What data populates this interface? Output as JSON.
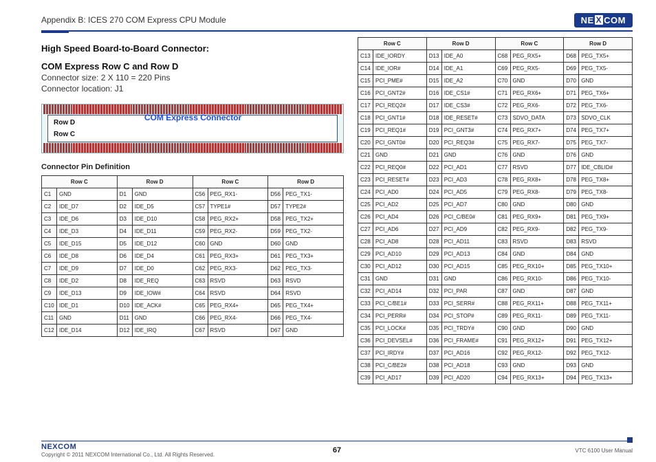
{
  "header": {
    "section": "Appendix B: ICES 270 COM Express CPU Module",
    "brand": "NEXCOM"
  },
  "title_block": {
    "line1": "High Speed Board-to-Board Connector:",
    "line2": "COM Express Row C and Row D",
    "size": "Connector size: 2 X 110 = 220 Pins",
    "location": "Connector location: J1"
  },
  "diagram": {
    "row_d_label": "Row D",
    "row_c_label": "Row C",
    "conn_title": "COM Express Connector"
  },
  "pin_def_title": "Connector Pin Definition",
  "table_headers": {
    "rowC": "Row C",
    "rowD": "Row D"
  },
  "left_table_rows": [
    [
      "C1",
      "GND",
      "D1",
      "GND",
      "C56",
      "PEG_RX1-",
      "D56",
      "PEG_TX1-"
    ],
    [
      "C2",
      "IDE_D7",
      "D2",
      "IDE_D5",
      "C57",
      "TYPE1#",
      "D57",
      "TYPE2#"
    ],
    [
      "C3",
      "IDE_D6",
      "D3",
      "IDE_D10",
      "C58",
      "PEG_RX2+",
      "D58",
      "PEG_TX2+"
    ],
    [
      "C4",
      "IDE_D3",
      "D4",
      "IDE_D11",
      "C59",
      "PEG_RX2-",
      "D59",
      "PEG_TX2-"
    ],
    [
      "C5",
      "IDE_D15",
      "D5",
      "IDE_D12",
      "C60",
      "GND",
      "D60",
      "GND"
    ],
    [
      "C6",
      "IDE_D8",
      "D6",
      "IDE_D4",
      "C61",
      "PEG_RX3+",
      "D61",
      "PEG_TX3+"
    ],
    [
      "C7",
      "IDE_D9",
      "D7",
      "IDE_D0",
      "C62",
      "PEG_RX3-",
      "D62",
      "PEG_TX3-"
    ],
    [
      "C8",
      "IDE_D2",
      "D8",
      "IDE_REQ",
      "C63",
      "RSVD",
      "D63",
      "RSVD"
    ],
    [
      "C9",
      "IDE_D13",
      "D9",
      "IDE_IOW#",
      "C64",
      "RSVD",
      "D64",
      "RSVD"
    ],
    [
      "C10",
      "IDE_D1",
      "D10",
      "IDE_ACK#",
      "C65",
      "PEG_RX4+",
      "D65",
      "PEG_TX4+"
    ],
    [
      "C11",
      "GND",
      "D11",
      "GND",
      "C66",
      "PEG_RX4-",
      "D66",
      "PEG_TX4-"
    ],
    [
      "C12",
      "IDE_D14",
      "D12",
      "IDE_IRQ",
      "C67",
      "RSVD",
      "D67",
      "GND"
    ]
  ],
  "right_table_rows": [
    [
      "C13",
      "IDE_IORDY",
      "D13",
      "IDE_A0",
      "C68",
      "PEG_RX5+",
      "D68",
      "PEG_TX5+"
    ],
    [
      "C14",
      "IDE_IOR#",
      "D14",
      "IDE_A1",
      "C69",
      "PEG_RX5-",
      "D69",
      "PEG_TX5-"
    ],
    [
      "C15",
      "PCI_PME#",
      "D15",
      "IDE_A2",
      "C70",
      "GND",
      "D70",
      "GND"
    ],
    [
      "C16",
      "PCI_GNT2#",
      "D16",
      "IDE_CS1#",
      "C71",
      "PEG_RX6+",
      "D71",
      "PEG_TX6+"
    ],
    [
      "C17",
      "PCI_REQ2#",
      "D17",
      "IDE_CS3#",
      "C72",
      "PEG_RX6-",
      "D72",
      "PEG_TX6-"
    ],
    [
      "C18",
      "PCI_GNT1#",
      "D18",
      "IDE_RESET#",
      "C73",
      "SDVO_DATA",
      "D73",
      "SDVO_CLK"
    ],
    [
      "C19",
      "PCI_REQ1#",
      "D19",
      "PCI_GNT3#",
      "C74",
      "PEG_RX7+",
      "D74",
      "PEG_TX7+"
    ],
    [
      "C20",
      "PCI_GNT0#",
      "D20",
      "PCI_REQ3#",
      "C75",
      "PEG_RX7-",
      "D75",
      "PEG_TX7-"
    ],
    [
      "C21",
      "GND",
      "D21",
      "GND",
      "C76",
      "GND",
      "D76",
      "GND"
    ],
    [
      "C22",
      "PCI_REQ0#",
      "D22",
      "PCI_AD1",
      "C77",
      "RSVD",
      "D77",
      "IDE_CBLID#"
    ],
    [
      "C23",
      "PCI_RESET#",
      "D23",
      "PCI_AD3",
      "C78",
      "PEG_RX8+",
      "D78",
      "PEG_TX8+"
    ],
    [
      "C24",
      "PCI_AD0",
      "D24",
      "PCI_AD5",
      "C79",
      "PEG_RX8-",
      "D79",
      "PEG_TX8-"
    ],
    [
      "C25",
      "PCI_AD2",
      "D25",
      "PCI_AD7",
      "C80",
      "GND",
      "D80",
      "GND"
    ],
    [
      "C26",
      "PCI_AD4",
      "D26",
      "PCI_C/BE0#",
      "C81",
      "PEG_RX9+",
      "D81",
      "PEG_TX9+"
    ],
    [
      "C27",
      "PCI_AD6",
      "D27",
      "PCI_AD9",
      "C82",
      "PEG_RX9-",
      "D82",
      "PEG_TX9-"
    ],
    [
      "C28",
      "PCI_AD8",
      "D28",
      "PCI_AD11",
      "C83",
      "RSVD",
      "D83",
      "RSVD"
    ],
    [
      "C29",
      "PCI_AD10",
      "D29",
      "PCI_AD13",
      "C84",
      "GND",
      "D84",
      "GND"
    ],
    [
      "C30",
      "PCI_AD12",
      "D30",
      "PCI_AD15",
      "C85",
      "PEG_RX10+",
      "D85",
      "PEG_TX10+"
    ],
    [
      "C31",
      "GND",
      "D31",
      "GND",
      "C86",
      "PEG_RX10-",
      "D86",
      "PEG_TX10-"
    ],
    [
      "C32",
      "PCI_AD14",
      "D32",
      "PCI_PAR",
      "C87",
      "GND",
      "D87",
      "GND"
    ],
    [
      "C33",
      "PCI_C/BE1#",
      "D33",
      "PCI_SERR#",
      "C88",
      "PEG_RX11+",
      "D88",
      "PEG_TX11+"
    ],
    [
      "C34",
      "PCI_PERR#",
      "D34",
      "PCI_STOP#",
      "C89",
      "PEG_RX11-",
      "D89",
      "PEG_TX11-"
    ],
    [
      "C35",
      "PCI_LOCK#",
      "D35",
      "PCI_TRDY#",
      "C90",
      "GND",
      "D90",
      "GND"
    ],
    [
      "C36",
      "PCI_DEVSEL#",
      "D36",
      "PCI_FRAME#",
      "C91",
      "PEG_RX12+",
      "D91",
      "PEG_TX12+"
    ],
    [
      "C37",
      "PCI_IRDY#",
      "D37",
      "PCI_AD16",
      "C92",
      "PEG_RX12-",
      "D92",
      "PEG_TX12-"
    ],
    [
      "C38",
      "PCI_C/BE2#",
      "D38",
      "PCI_AD18",
      "C93",
      "GND",
      "D93",
      "GND"
    ],
    [
      "C39",
      "PCI_AD17",
      "D39",
      "PCI_AD20",
      "C94",
      "PEG_RX13+",
      "D94",
      "PEG_TX13+"
    ]
  ],
  "footer": {
    "brand": "NEXCOM",
    "copyright": "Copyright © 2011 NEXCOM International Co., Ltd. All Rights Reserved.",
    "page": "67",
    "manual": "VTC 6100 User Manual"
  }
}
